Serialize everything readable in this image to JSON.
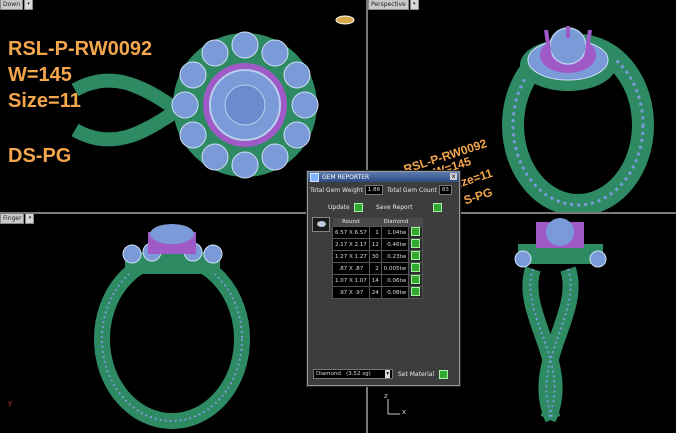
{
  "viewports": {
    "top_left_label": "Down",
    "top_right_label": "Perspective",
    "bottom_left_label": "Finger",
    "bottom_right_label": ""
  },
  "overlay": {
    "line1": "RSL-P-RW0092",
    "line2": "W=145",
    "line3": "Size=11",
    "line4": "DS-PG",
    "persp_line1": "RSL-P-RW0092",
    "persp_line2": "W=145",
    "persp_line3": "ize=11",
    "persp_line4": "S-PG"
  },
  "axes": {
    "y": "y",
    "x": "x",
    "z": "z"
  },
  "gem_reporter": {
    "title": "GEM REPORTER",
    "close": "x",
    "total_gem_weight_label": "Total Gem Weight",
    "total_gem_weight_value": "1.88",
    "total_gem_count_label": "Total Gem Count",
    "total_gem_count_value": "83",
    "update_label": "Update",
    "save_report_label": "Save Report",
    "col_shape": "Round",
    "col_material": "Diamond",
    "rows": [
      {
        "size": "6.57 X 6.57",
        "count": "1",
        "weight": "1.04tw"
      },
      {
        "size": "2.17 X 2.17",
        "count": "12",
        "weight": "0.46tw"
      },
      {
        "size": "1.27 X 1.27",
        "count": "30",
        "weight": "0.23tw"
      },
      {
        "size": ".87 X .87",
        "count": "2",
        "weight": "0.005tw"
      },
      {
        "size": "1.07 X 1.07",
        "count": "14",
        "weight": "0.06tw"
      },
      {
        "size": ".97 X .97",
        "count": "24",
        "weight": "0.08tw"
      }
    ],
    "material_select": "Diamond",
    "material_sg": "(3.52 sg)",
    "set_material_label": "Set Material"
  },
  "colors": {
    "metal": "#2e8a62",
    "gem": "#7a9bd8",
    "prong": "#a05ac8",
    "label": "#f4a64d"
  }
}
